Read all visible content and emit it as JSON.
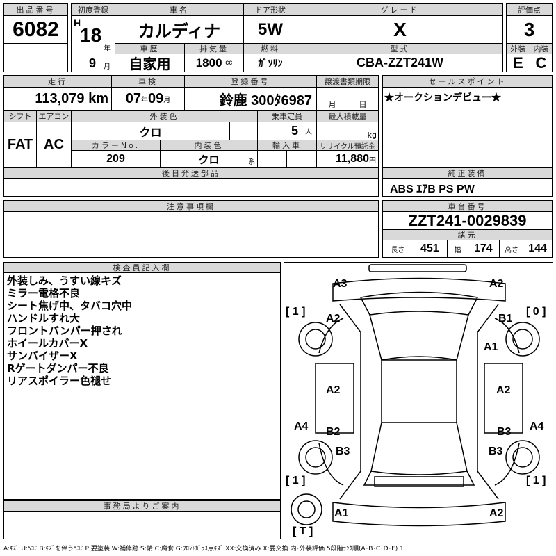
{
  "lot": {
    "label": "出品番号",
    "value": "6082"
  },
  "first_reg": {
    "label": "初度登録",
    "era": "H",
    "year": "18",
    "year_unit": "年",
    "month": "9",
    "month_unit": "月"
  },
  "car_name": {
    "label": "車名",
    "value": "カルディナ"
  },
  "door": {
    "label": "ドア形状",
    "value": "5W"
  },
  "grade": {
    "label": "グレード",
    "value": "X"
  },
  "history": {
    "label": "車歴",
    "value": "自家用"
  },
  "displacement": {
    "label": "排気量",
    "value": "1800",
    "unit": "cc"
  },
  "fuel": {
    "label": "燃料",
    "value": "ｶﾞｿﾘﾝ"
  },
  "model": {
    "label": "型式",
    "value": "CBA-ZZT241W"
  },
  "score": {
    "label": "評価点",
    "value": "3",
    "ext_label": "外装",
    "ext": "E",
    "int_label": "内装",
    "int": "C"
  },
  "mileage": {
    "label": "走行",
    "value": "113,079",
    "unit": "km"
  },
  "inspection": {
    "label": "車検",
    "year": "07",
    "year_unit": "年",
    "month": "09",
    "month_unit": "月"
  },
  "plate": {
    "label": "登録番号",
    "value": "鈴鹿 300ﾀ6987"
  },
  "transfer": {
    "label": "譲渡書類期限",
    "month_unit": "月",
    "day_unit": "日"
  },
  "shift": {
    "label": "シフト",
    "value": "FAT"
  },
  "ac": {
    "label": "エアコン",
    "value": "AC"
  },
  "ext_color": {
    "label": "外装色",
    "value": "クロ"
  },
  "capacity": {
    "label": "乗車定員",
    "value": "5",
    "unit": "人"
  },
  "max_load": {
    "label": "最大積載量",
    "unit": "kg"
  },
  "color_no": {
    "label": "カラーNo.",
    "value": "209"
  },
  "int_color": {
    "label": "内装色",
    "value": "クロ",
    "suffix": "系"
  },
  "import": {
    "label": "輸入車"
  },
  "recycle": {
    "label": "リサイクル預託金",
    "value": "11,880",
    "unit": "円"
  },
  "later_parts": {
    "label": "後日発送部品"
  },
  "sales_point": {
    "label": "セールスポイント",
    "value": "★オークションデビュー★"
  },
  "equipment": {
    "label": "純正装備",
    "value": "ABS ｴｱB PS PW"
  },
  "notes": {
    "label": "注意事項欄"
  },
  "chassis": {
    "label": "車台番号",
    "value": "ZZT241-0029839"
  },
  "specs": {
    "label": "諸元",
    "length_label": "長さ",
    "length": "451",
    "width_label": "幅",
    "width": "174",
    "height_label": "高さ",
    "height": "144"
  },
  "inspector": {
    "label": "検査員記入欄",
    "lines": [
      "外装しみ、うすい線キズ",
      "ミラー電格不良",
      "シート焦げ中、タバコ穴中",
      "ハンドルすれ大",
      "フロントバンパー押され",
      "ホイールカバーX",
      "サンバイザーX",
      "Rゲートダンパー不良",
      "リアスポイラー色褪せ"
    ]
  },
  "office": {
    "label": "事務局よりご案内"
  },
  "diagram": {
    "marks": [
      "A3",
      "A2",
      "A2",
      "B1",
      "A1",
      "A2",
      "A2",
      "A4",
      "A4",
      "B2",
      "B3",
      "B3",
      "B3",
      "A1",
      "A2"
    ],
    "tire_left_front": "[ 1 ]",
    "tire_right_front": "[ 0 ]",
    "tire_left_rear": "[ 1 ]",
    "tire_right_rear": "[ 1 ]",
    "spare": "[ T ]"
  },
  "legend": "A:ｷｽﾞ U:ﾍｺﾐ B:ｷｽﾞを伴うﾍｺﾐ P:要塗装 W:補修跡 S:錆 C:腐食 G:ﾌﾛﾝﾄｶﾞﾗｽ点ｷｽﾞ XX:交換済み X:要交換 内･外装評価 5段階ﾗﾝｸ順(A･B･C･D･E) 1"
}
